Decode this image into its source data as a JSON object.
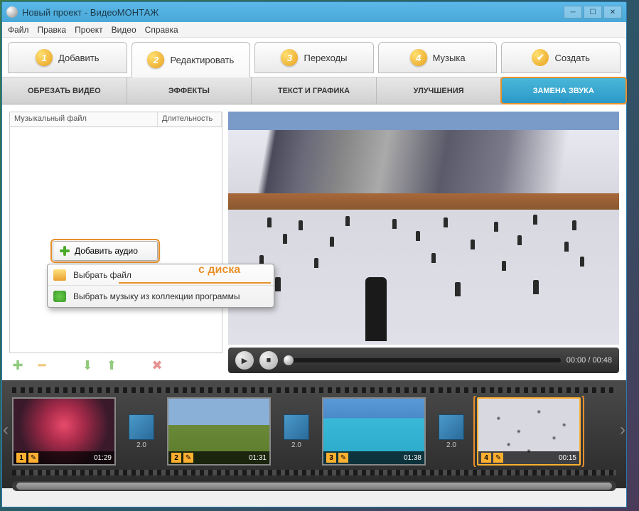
{
  "title": "Новый проект - ВидеоМОНТАЖ",
  "menu": {
    "file": "Файл",
    "edit": "Правка",
    "project": "Проект",
    "video": "Видео",
    "help": "Справка"
  },
  "steps": {
    "add": "Добавить",
    "editstep": "Редактировать",
    "transitions": "Переходы",
    "music": "Музыка",
    "create": "Создать",
    "n1": "1",
    "n2": "2",
    "n3": "3",
    "n4": "4",
    "check": "✔"
  },
  "subtabs": {
    "trim": "ОБРЕЗАТЬ ВИДЕО",
    "effects": "ЭФФЕКТЫ",
    "text": "ТЕКСТ И ГРАФИКА",
    "improve": "УЛУЧШЕНИЯ",
    "replace": "ЗАМЕНА ЗВУКА"
  },
  "listhdr": {
    "file": "Музыкальный файл",
    "length": "Длительность"
  },
  "addaudio": "Добавить аудио",
  "ctx": {
    "pick": "Выбрать файл",
    "frommem": "Выбрать музыку из коллекции программы",
    "annot": "с диска"
  },
  "player": {
    "time": "00:00 / 00:48",
    "play": "▶",
    "stop": "■"
  },
  "timeline": {
    "transdur": "2.0",
    "clips": [
      {
        "idx": "1",
        "dur": "01:29"
      },
      {
        "idx": "2",
        "dur": "01:31"
      },
      {
        "idx": "3",
        "dur": "01:38"
      },
      {
        "idx": "4",
        "dur": "00:15"
      }
    ]
  },
  "leftctrls": {
    "add": "✚",
    "remove": "━",
    "down": "⬇",
    "up": "⬆",
    "del": "✖"
  }
}
